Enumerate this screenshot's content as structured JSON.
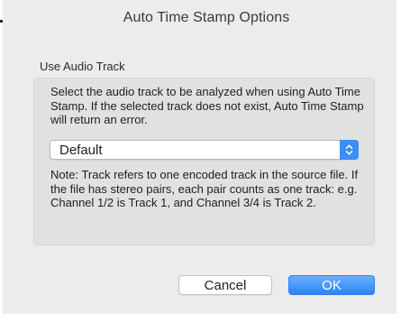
{
  "dialog": {
    "title": "Auto Time Stamp Options"
  },
  "group": {
    "label": "Use Audio Track",
    "description": "Select the audio track to be analyzed when using Auto Time Stamp. If the selected track does not exist, Auto Time Stamp will return an error.",
    "track_select": {
      "selected_value": "Default",
      "icon": "up-down-chevron-icon"
    },
    "note": "Note: Track refers to one encoded track in the source file. If the file has stereo pairs, each pair counts as one track: e.g. Channel 1/2 is Track 1, and Channel 3/4 is Track 2."
  },
  "buttons": {
    "cancel_label": "Cancel",
    "ok_label": "OK"
  },
  "colors": {
    "accent": "#3a8ef5",
    "window_bg": "#ececec",
    "group_bg": "#e1e1e1"
  }
}
